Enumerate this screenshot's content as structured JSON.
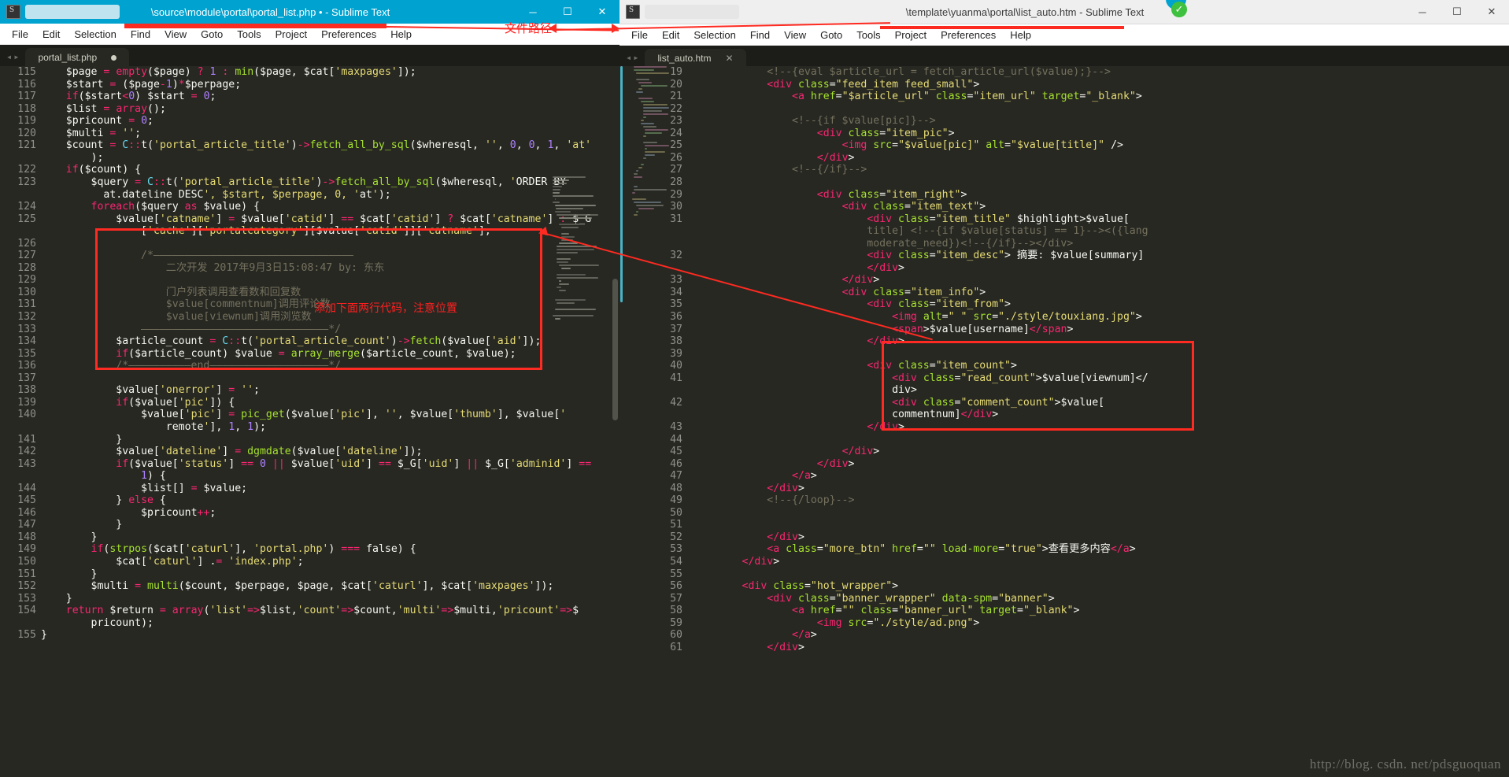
{
  "left_window": {
    "title": "\\source\\module\\portal\\portal_list.php • - Sublime Text",
    "menu": [
      "File",
      "Edit",
      "Selection",
      "Find",
      "View",
      "Goto",
      "Tools",
      "Project",
      "Preferences",
      "Help"
    ],
    "tab": "portal_list.php",
    "window_buttons": {
      "minimize": "─",
      "maximize": "☐",
      "close": "✕"
    },
    "code_lines": [
      {
        "n": "115",
        "text": "    $page = empty($page) ? 1 : min($page, $cat['maxpages']);"
      },
      {
        "n": "116",
        "text": "    $start = ($page-1)*$perpage;"
      },
      {
        "n": "117",
        "text": "    if($start<0) $start = 0;"
      },
      {
        "n": "118",
        "text": "    $list = array();"
      },
      {
        "n": "119",
        "text": "    $pricount = 0;"
      },
      {
        "n": "120",
        "text": "    $multi = '';"
      },
      {
        "n": "121",
        "text": "    $count = C::t('portal_article_title')->fetch_all_by_sql($wheresql, '', 0, 0, 1, 'at'"
      },
      {
        "n": "",
        "text": "        );"
      },
      {
        "n": "122",
        "text": "    if($count) {"
      },
      {
        "n": "123",
        "text": "        $query = C::t('portal_article_title')->fetch_all_by_sql($wheresql, 'ORDER BY"
      },
      {
        "n": "",
        "text": "          at.dateline DESC', $start, $perpage, 0, 'at');"
      },
      {
        "n": "124",
        "text": "        foreach($query as $value) {"
      },
      {
        "n": "125",
        "text": "            $value['catname'] = $value['catid'] == $cat['catid'] ? $cat['catname'] : $_G"
      },
      {
        "n": "",
        "text": "                ['cache']['portalcategory'][$value['catid']]['catname'];"
      },
      {
        "n": "126",
        "text": ""
      },
      {
        "n": "127",
        "text": "                /*————————————————————————————————"
      },
      {
        "n": "128",
        "text": "                    二次开发 2017年9月3日15:08:47 by: 东东"
      },
      {
        "n": "129",
        "text": ""
      },
      {
        "n": "130",
        "text": "                    门户列表调用查看数和回复数"
      },
      {
        "n": "131",
        "text": "                    $value[commentnum]调用评论数"
      },
      {
        "n": "132",
        "text": "                    $value[viewnum]调用浏览数"
      },
      {
        "n": "133",
        "text": "                ——————————————————————————————*/"
      },
      {
        "n": "134",
        "text": "            $article_count = C::t('portal_article_count')->fetch($value['aid']);"
      },
      {
        "n": "135",
        "text": "            if($article_count) $value = array_merge($article_count, $value);"
      },
      {
        "n": "136",
        "text": "            /*——————————end———————————————————*/"
      },
      {
        "n": "137",
        "text": ""
      },
      {
        "n": "138",
        "text": "            $value['onerror'] = '';"
      },
      {
        "n": "139",
        "text": "            if($value['pic']) {"
      },
      {
        "n": "140",
        "text": "                $value['pic'] = pic_get($value['pic'], '', $value['thumb'], $value['"
      },
      {
        "n": "",
        "text": "                    remote'], 1, 1);"
      },
      {
        "n": "141",
        "text": "            }"
      },
      {
        "n": "142",
        "text": "            $value['dateline'] = dgmdate($value['dateline']);"
      },
      {
        "n": "143",
        "text": "            if($value['status'] == 0 || $value['uid'] == $_G['uid'] || $_G['adminid'] =="
      },
      {
        "n": "",
        "text": "                1) {"
      },
      {
        "n": "144",
        "text": "                $list[] = $value;"
      },
      {
        "n": "145",
        "text": "            } else {"
      },
      {
        "n": "146",
        "text": "                $pricount++;"
      },
      {
        "n": "147",
        "text": "            }"
      },
      {
        "n": "148",
        "text": "        }"
      },
      {
        "n": "149",
        "text": "        if(strpos($cat['caturl'], 'portal.php') === false) {"
      },
      {
        "n": "150",
        "text": "            $cat['caturl'] .= 'index.php';"
      },
      {
        "n": "151",
        "text": "        }"
      },
      {
        "n": "152",
        "text": "        $multi = multi($count, $perpage, $page, $cat['caturl'], $cat['maxpages']);"
      },
      {
        "n": "153",
        "text": "    }"
      },
      {
        "n": "154",
        "text": "    return $return = array('list'=>$list,'count'=>$count,'multi'=>$multi,'pricount'=>$"
      },
      {
        "n": "",
        "text": "        pricount);"
      },
      {
        "n": "155",
        "text": "}"
      }
    ]
  },
  "right_window": {
    "title": "\\template\\yuanma\\portal\\list_auto.htm - Sublime Text",
    "menu": [
      "File",
      "Edit",
      "Selection",
      "Find",
      "View",
      "Goto",
      "Tools",
      "Project",
      "Preferences",
      "Help"
    ],
    "tab": "list_auto.htm",
    "tab_close": "✕",
    "window_buttons": {
      "minimize": "─",
      "maximize": "☐",
      "close": "✕"
    },
    "code_lines": [
      {
        "n": "19",
        "text": "            <!--{eval $article_url = fetch_article_url($value);}-->"
      },
      {
        "n": "20",
        "text": "            <div class=\"feed_item feed_small\">"
      },
      {
        "n": "21",
        "text": "                <a href=\"$article_url\" class=\"item_url\" target=\"_blank\">"
      },
      {
        "n": "22",
        "text": ""
      },
      {
        "n": "23",
        "text": "                <!--{if $value[pic]}-->"
      },
      {
        "n": "24",
        "text": "                    <div class=\"item_pic\">"
      },
      {
        "n": "25",
        "text": "                        <img src=\"$value[pic]\" alt=\"$value[title]\" />"
      },
      {
        "n": "26",
        "text": "                    </div>"
      },
      {
        "n": "27",
        "text": "                <!--{/if}-->"
      },
      {
        "n": "28",
        "text": ""
      },
      {
        "n": "29",
        "text": "                    <div class=\"item_right\">"
      },
      {
        "n": "30",
        "text": "                        <div class=\"item_text\">"
      },
      {
        "n": "31",
        "text": "                            <div class=\"item_title\" $highlight>$value["
      },
      {
        "n": "",
        "text": "                            title] <!--{if $value[status] == 1}--><({lang"
      },
      {
        "n": "",
        "text": "                            moderate_need})<!--{/if}--></div>"
      },
      {
        "n": "32",
        "text": "                            <div class=\"item_desc\"> 摘要: $value[summary]"
      },
      {
        "n": "",
        "text": "                            </div>"
      },
      {
        "n": "33",
        "text": "                        </div>"
      },
      {
        "n": "34",
        "text": "                        <div class=\"item_info\">"
      },
      {
        "n": "35",
        "text": "                            <div class=\"item_from\">"
      },
      {
        "n": "36",
        "text": "                                <img alt=\" \" src=\"./style/touxiang.jpg\">"
      },
      {
        "n": "37",
        "text": "                                <span>$value[username]</span>"
      },
      {
        "n": "38",
        "text": "                            </div>"
      },
      {
        "n": "39",
        "text": ""
      },
      {
        "n": "40",
        "text": "                            <div class=\"item_count\">"
      },
      {
        "n": "41",
        "text": "                                <div class=\"read_count\">$value[viewnum]</"
      },
      {
        "n": "",
        "text": "                                div>"
      },
      {
        "n": "42",
        "text": "                                <div class=\"comment_count\">$value["
      },
      {
        "n": "",
        "text": "                                commentnum]</div>"
      },
      {
        "n": "43",
        "text": "                            </div>"
      },
      {
        "n": "44",
        "text": ""
      },
      {
        "n": "45",
        "text": "                        </div>"
      },
      {
        "n": "46",
        "text": "                    </div>"
      },
      {
        "n": "47",
        "text": "                </a>"
      },
      {
        "n": "48",
        "text": "            </div>"
      },
      {
        "n": "49",
        "text": "            <!--{/loop}-->"
      },
      {
        "n": "50",
        "text": ""
      },
      {
        "n": "51",
        "text": ""
      },
      {
        "n": "52",
        "text": "            </div>"
      },
      {
        "n": "53",
        "text": "            <a class=\"more_btn\" href=\"\" load-more=\"true\">查看更多内容</a>"
      },
      {
        "n": "54",
        "text": "        </div>"
      },
      {
        "n": "55",
        "text": ""
      },
      {
        "n": "56",
        "text": "        <div class=\"hot_wrapper\">"
      },
      {
        "n": "57",
        "text": "            <div class=\"banner_wrapper\" data-spm=\"banner\">"
      },
      {
        "n": "58",
        "text": "                <a href=\"\" class=\"banner_url\" target=\"_blank\">"
      },
      {
        "n": "59",
        "text": "                    <img src=\"./style/ad.png\">"
      },
      {
        "n": "60",
        "text": "                </a>"
      },
      {
        "n": "61",
        "text": "            </div>"
      }
    ]
  },
  "annotations": {
    "file_path_label": "文件路径",
    "add_code_note": "添加下面两行代码，注意位置"
  },
  "watermark": "http://blog. csdn. net/pdsguoquan",
  "colors": {
    "titlebar_blue": "#00a2cf",
    "editor_bg": "#272822",
    "annotation_red": "#ff2a21",
    "keyword": "#f92672",
    "string": "#e6db74",
    "function": "#a6e22e",
    "comment": "#75715e",
    "number": "#ae81ff",
    "class": "#66d9ef"
  }
}
